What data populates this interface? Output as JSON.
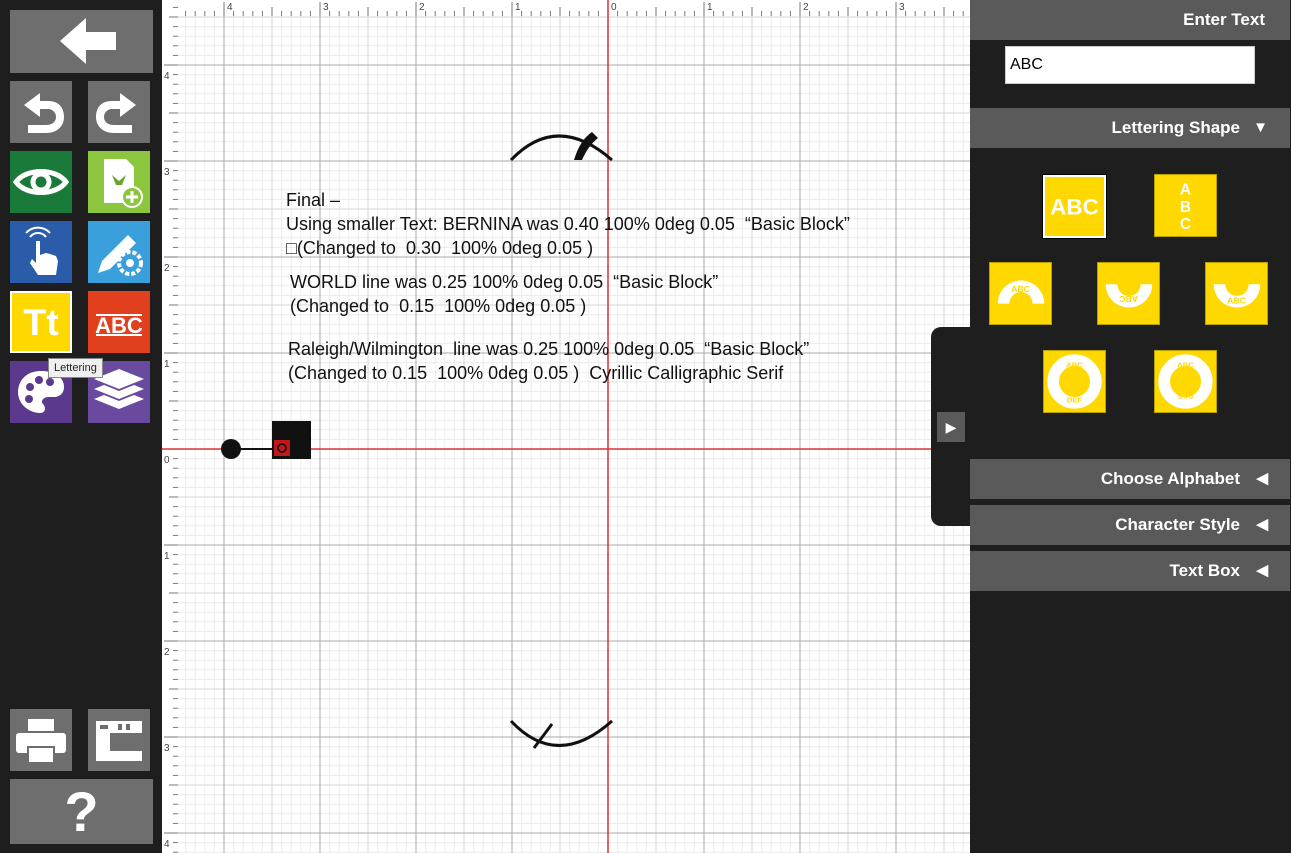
{
  "toolbar": {
    "tooltip": "Lettering",
    "help_label": "?",
    "lettering_label": "Tt",
    "monogram_label": "ABC"
  },
  "ruler": {
    "top_ticks": [
      "4",
      "3",
      "2",
      "1",
      "0",
      "1",
      "2",
      "3"
    ],
    "left_ticks": [
      "4",
      "3",
      "2",
      "1",
      "0",
      "1",
      "2",
      "3",
      "4"
    ]
  },
  "canvas_notes": {
    "line1": "Final –",
    "line2": "Using smaller Text: BERNINA was 0.40 100% 0deg 0.05  “Basic Block”",
    "line3": "□(Changed to  0.30  100% 0deg 0.05 )",
    "line4": "WORLD line was 0.25 100% 0deg 0.05  “Basic Block”",
    "line5": "(Changed to  0.15  100% 0deg 0.05 )",
    "line6": "Raleigh/Wilmington  line was 0.25 100% 0deg 0.05  “Basic Block”",
    "line7": "(Changed to 0.15  100% 0deg 0.05 )  Cyrillic Calligraphic Serif"
  },
  "panel": {
    "enter_text": "Enter Text",
    "text_value": "ABC",
    "lettering_shape": "Lettering Shape",
    "choose_alphabet": "Choose Alphabet",
    "character_style": "Character Style",
    "text_box": "Text Box",
    "arrow_down": "▼",
    "arrow_left": "◀",
    "flyout_arrow": "▶",
    "shapes": [
      {
        "name": "straight",
        "label": "ABC"
      },
      {
        "name": "vertical",
        "label": "A B C"
      },
      {
        "name": "arc-top",
        "label": "ABC"
      },
      {
        "name": "arc-bottom-flipped",
        "label": "ABC"
      },
      {
        "name": "arc-bottom",
        "label": "ABC"
      },
      {
        "name": "circle",
        "top": "ABC",
        "bottom": "DEF"
      },
      {
        "name": "circle-flipped",
        "top": "ABC",
        "bottom": "DEF"
      }
    ]
  },
  "colors": {
    "accent_yellow": "#ffd800",
    "green_dark": "#1a7a3a",
    "green_light": "#8cc63f",
    "blue": "#2a5caa",
    "sky": "#3aa0dc",
    "red": "#e0401e",
    "purple": "#5b3a8e",
    "axis_red": "#e03030"
  }
}
